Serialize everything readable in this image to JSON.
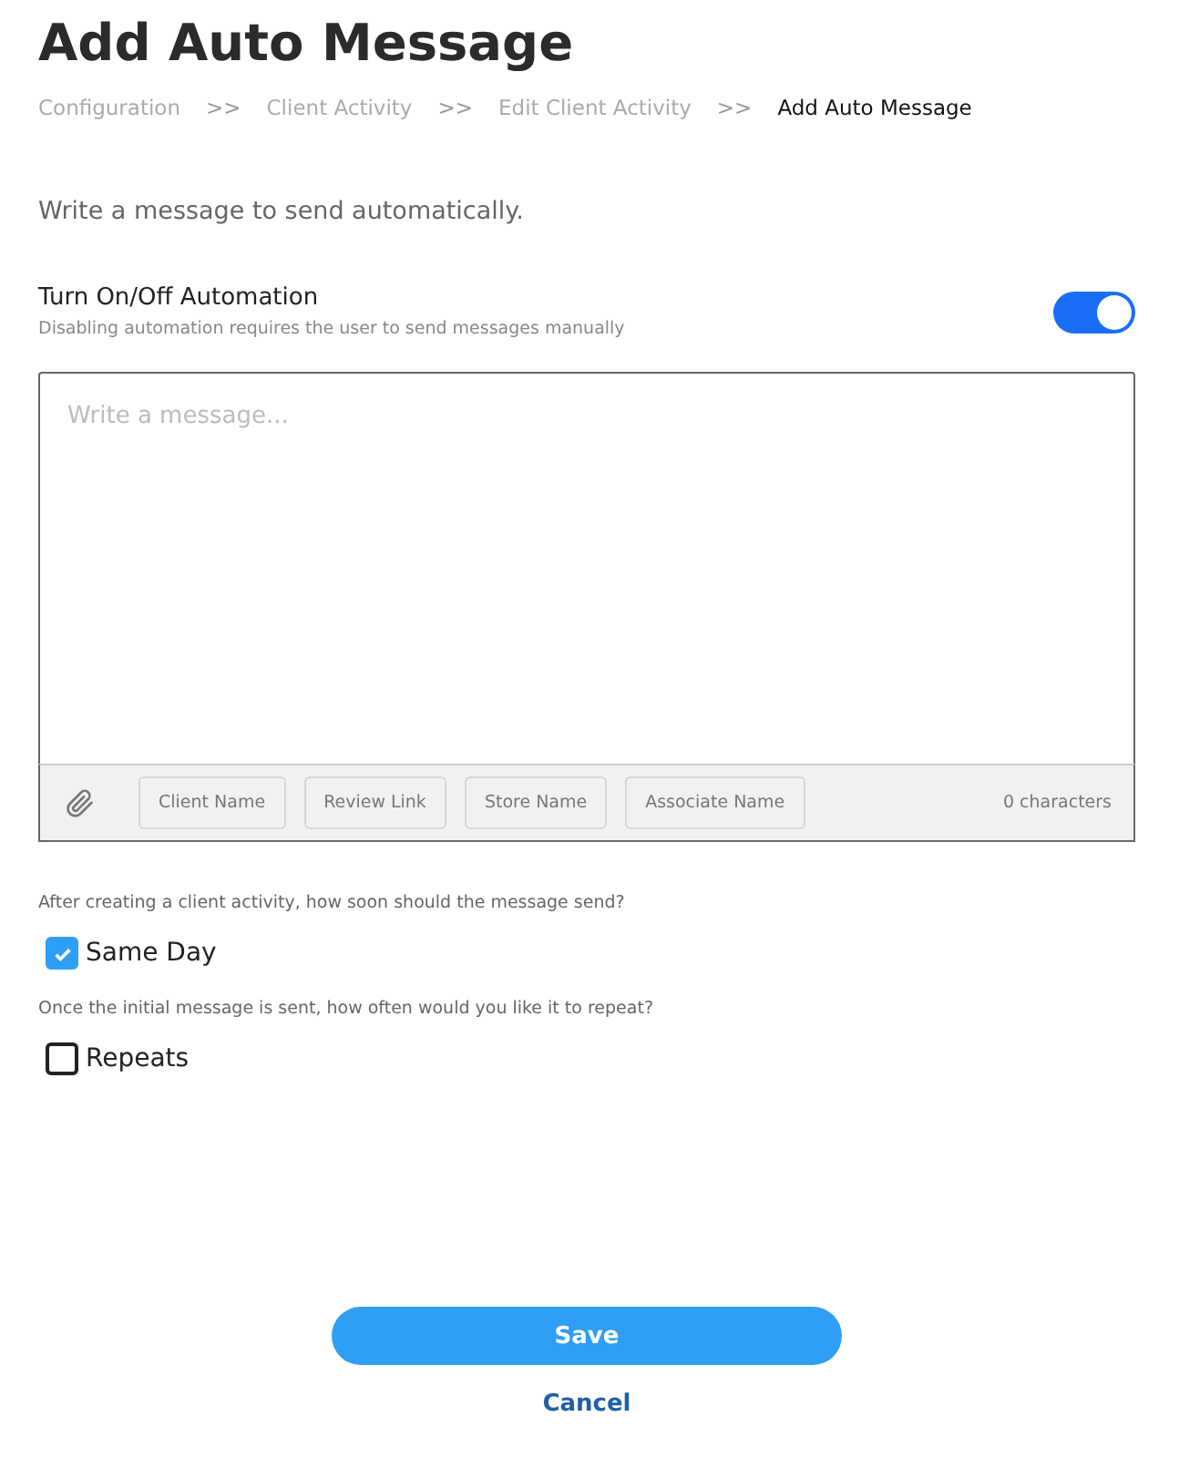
{
  "title": "Add Auto Message",
  "breadcrumb": [
    {
      "label": "Configuration",
      "selected": false
    },
    {
      "label": "Client Activity",
      "selected": false
    },
    {
      "label": "Edit Client Activity",
      "selected": false
    },
    {
      "label": "Add Auto Message",
      "selected": true
    }
  ],
  "breadcrumb_separator": ">>",
  "description": "Write a message to send automatically.",
  "automation": {
    "label": "Turn On/Off Automation",
    "hint": "Disabling automation requires the user to send messages manually",
    "on": true
  },
  "message": {
    "placeholder": "Write a message...",
    "tags": [
      "Client Name",
      "Review Link",
      "Store Name",
      "Associate Name"
    ],
    "count": "0 characters"
  },
  "options": [
    {
      "question": "After creating a client activity, how soon should the message send?",
      "label": "Same Day",
      "checked": true
    },
    {
      "question": "Once the initial message is sent, how often would you like it to repeat?",
      "label": "Repeats",
      "checked": false
    }
  ],
  "buttons": {
    "save": "Save",
    "cancel": "Cancel"
  }
}
